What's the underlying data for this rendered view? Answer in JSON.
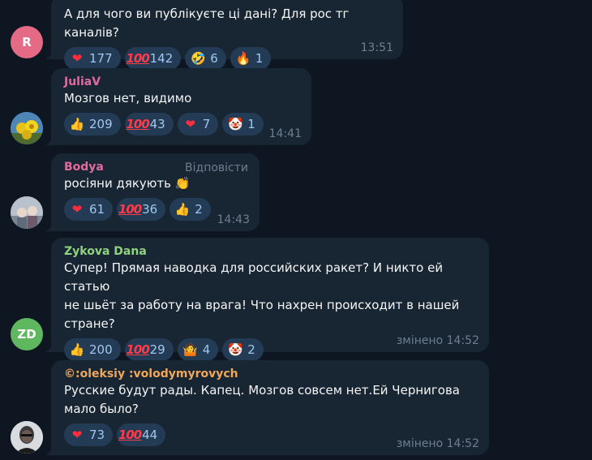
{
  "messages": [
    {
      "avatar": {
        "initials": "R",
        "color": "#e56a85"
      },
      "name": "",
      "name_color": "",
      "reply": "",
      "text": [
        "А для чого ви публікуєте ці дані? Для рос тг каналів?"
      ],
      "reactions": [
        {
          "icon": "heart-icon",
          "glyph": "❤",
          "count": "177"
        },
        {
          "icon": "hundred-points-icon",
          "glyph": "100",
          "count": "142"
        },
        {
          "icon": "rolling-laughing-icon",
          "glyph": "🤣",
          "count": "6"
        },
        {
          "icon": "fire-icon",
          "glyph": "🔥",
          "count": "1"
        }
      ],
      "time": "13:51"
    },
    {
      "avatar": {
        "initials": "",
        "color": "#4a6b8a"
      },
      "name": "JuliaV",
      "name_color": "#e06c9f",
      "reply": "",
      "text": [
        "Мозгов нет, видимо"
      ],
      "reactions": [
        {
          "icon": "thumbs-up-icon",
          "glyph": "👍",
          "count": "209"
        },
        {
          "icon": "hundred-points-icon",
          "glyph": "100",
          "count": "43"
        },
        {
          "icon": "heart-icon",
          "glyph": "❤",
          "count": "7"
        },
        {
          "icon": "clown-face-icon",
          "glyph": "🤡",
          "count": "1"
        }
      ],
      "time": "14:41"
    },
    {
      "avatar": {
        "initials": "",
        "color": "#8a94a3"
      },
      "name": "Bodya",
      "name_color": "#e06c9f",
      "reply": "Відповісти",
      "text": [
        "росіяни дякують 👏"
      ],
      "reactions": [
        {
          "icon": "heart-icon",
          "glyph": "❤",
          "count": "61"
        },
        {
          "icon": "hundred-points-icon",
          "glyph": "100",
          "count": "36"
        },
        {
          "icon": "thumbs-up-icon",
          "glyph": "👍",
          "count": "2"
        }
      ],
      "time": "14:43"
    },
    {
      "avatar": {
        "initials": "ZD",
        "color": "#5fb85f"
      },
      "name": "Zykova Dana",
      "name_color": "#8fd47c",
      "reply": "",
      "text": [
        "Супер! Прямая наводка для российских ракет? И никто ей статью",
        "не шьёт за работу на врага! Что нахрен происходит в нашей",
        "стране?"
      ],
      "reactions": [
        {
          "icon": "thumbs-up-icon",
          "glyph": "👍",
          "count": "200"
        },
        {
          "icon": "hundred-points-icon",
          "glyph": "100",
          "count": "29"
        },
        {
          "icon": "person-shrugging-icon",
          "glyph": "🤷",
          "count": "4"
        },
        {
          "icon": "clown-face-icon",
          "glyph": "🤡",
          "count": "2"
        }
      ],
      "time": "змінено 14:52"
    },
    {
      "avatar": {
        "initials": "",
        "color": "#cfd3d6"
      },
      "name": "©:oleksiy :volodymyrovych",
      "name_color": "#f0a75a",
      "reply": "",
      "text": [
        "Русские будут рады. Капец. Мозгов совсем нет.Ей Чернигова",
        "мало было?"
      ],
      "reactions": [
        {
          "icon": "heart-icon",
          "glyph": "❤",
          "count": "73"
        },
        {
          "icon": "hundred-points-icon",
          "glyph": "100",
          "count": "44"
        }
      ],
      "time": "змінено 14:52"
    }
  ]
}
